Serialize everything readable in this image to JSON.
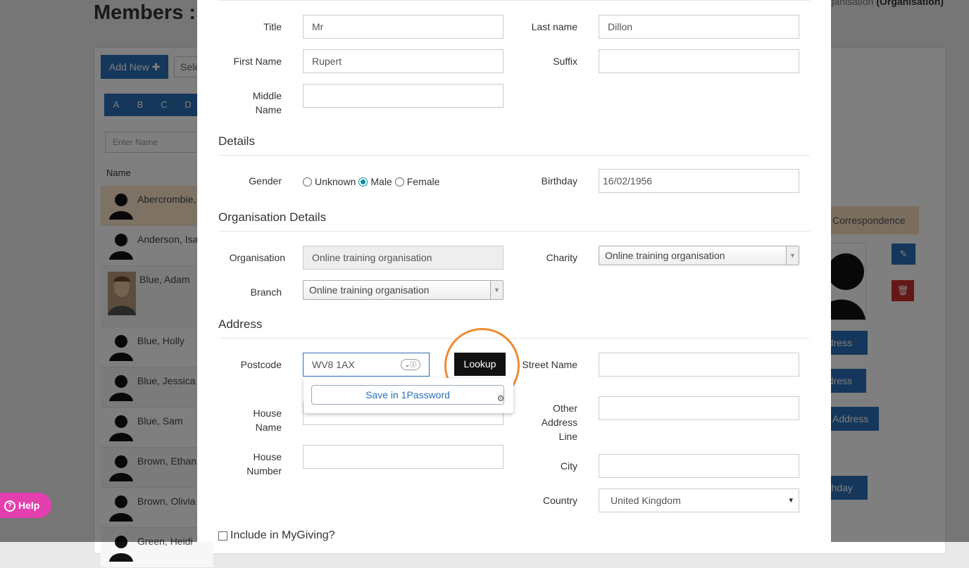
{
  "background": {
    "page_title": "Members :",
    "breadcrumb_prefix": "ganisation",
    "breadcrumb_current": "(Organisation)",
    "add_new_label": "Add New",
    "select_label": "Sele",
    "letters": [
      "A",
      "B",
      "C",
      "D"
    ],
    "search_placeholder": "Enter Name",
    "name_header": "Name",
    "members": [
      "Abercrombie,",
      "Anderson, Isa",
      "Blue, Adam",
      "Blue, Holly",
      "Blue, Jessica",
      "Blue, Sam",
      "Brown, Ethan",
      "Brown, Olivia",
      "Green, Heidi"
    ],
    "correspondence_tab": "Correspondence",
    "address_btn_1": "ddress",
    "address_btn_2": "ddress",
    "address_btn_3": "Address",
    "birthday_btn": "rthday",
    "help_label": "Help"
  },
  "form": {
    "title_label": "Title",
    "title_value": "Mr",
    "last_name_label": "Last name",
    "last_name_value": "Dillon",
    "first_name_label": "First Name",
    "first_name_value": "Rupert",
    "suffix_label": "Suffix",
    "suffix_value": "",
    "middle_name_label": "Middle Name",
    "middle_name_value": "",
    "details_heading": "Details",
    "gender_label": "Gender",
    "gender_options": [
      "Unknown",
      "Male",
      "Female"
    ],
    "gender_selected": "Male",
    "birthday_label": "Birthday",
    "birthday_value": "16/02/1956",
    "org_heading": "Organisation Details",
    "organisation_label": "Organisation",
    "organisation_value": "Online training organisation",
    "charity_label": "Charity",
    "charity_value": "Online training organisation",
    "branch_label": "Branch",
    "branch_value": "Online training organisation",
    "address_heading": "Address",
    "postcode_label": "Postcode",
    "postcode_value": "WV8 1AX",
    "lookup_label": "Lookup",
    "onepassword_save": "Save in 1Password",
    "street_name_label": "Street Name",
    "street_name_value": "",
    "house_name_label": "House Name",
    "house_name_value": "",
    "other_address_label": "Other Address Line",
    "other_address_value": "",
    "house_number_label": "House Number",
    "house_number_value": "",
    "city_label": "City",
    "city_value": "",
    "country_label": "Country",
    "country_value": "United Kingdom",
    "mygiving_label": "Include in MyGiving?"
  },
  "colors": {
    "primary": "#2a6fb6",
    "highlight_ring": "#ef8a32",
    "help": "#e33fae",
    "radio_checked": "#0b8ea8"
  }
}
